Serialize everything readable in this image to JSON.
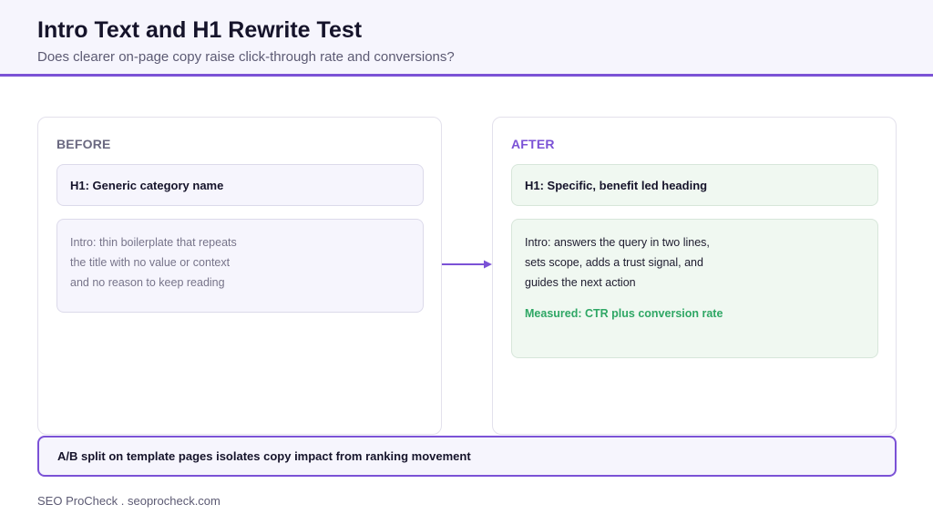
{
  "header": {
    "title": "Intro Text and H1 Rewrite Test",
    "subtitle": "Does clearer on-page copy raise click-through rate and conversions?"
  },
  "before": {
    "label": "BEFORE",
    "h1": "H1: Generic category name",
    "intro_lines": [
      "Intro: thin boilerplate that repeats",
      "the title with no value or context",
      "and no reason to keep reading"
    ]
  },
  "after": {
    "label": "AFTER",
    "h1": "H1: Specific, benefit led heading",
    "intro_lines": [
      "Intro: answers the query in two lines,",
      "sets scope, adds a trust signal, and",
      "guides the next action"
    ],
    "measured": "Measured: CTR plus conversion rate"
  },
  "banner": "A/B split on template pages isolates copy impact from ranking movement",
  "footer": "SEO ProCheck . seoprocheck.com",
  "colors": {
    "accent": "#7b52d6",
    "success": "#2fa765",
    "muted": "#6a6880"
  },
  "icons": {
    "connector": "right-arrow-icon"
  }
}
